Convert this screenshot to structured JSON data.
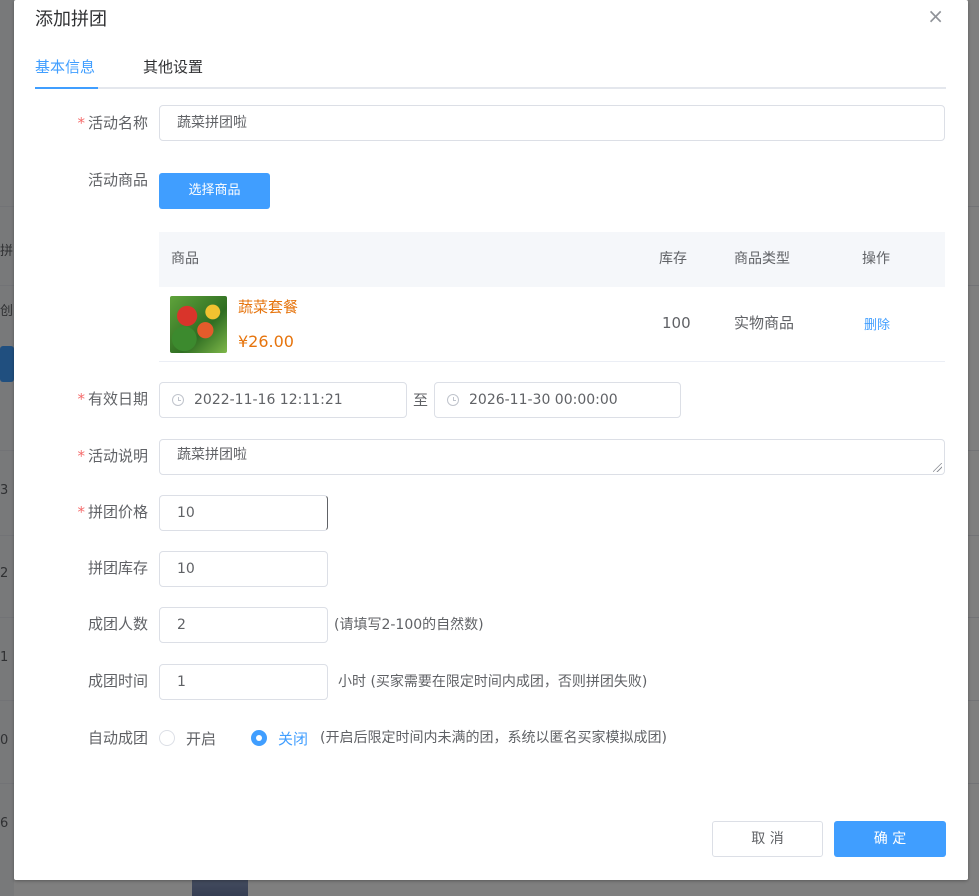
{
  "background": {
    "chars": [
      "拼团",
      "创",
      "3",
      "2",
      "1",
      "0",
      "6"
    ]
  },
  "dialog": {
    "title": "添加拼团",
    "close_glyph": "×"
  },
  "tabs": [
    {
      "label": "基本信息",
      "active": true
    },
    {
      "label": "其他设置",
      "active": false
    }
  ],
  "form": {
    "required_mark": "*",
    "activity_name": {
      "label": "活动名称",
      "value": "蔬菜拼团啦"
    },
    "activity_goods": {
      "label": "活动商品",
      "button": "选择商品"
    },
    "goods_table": {
      "headers": {
        "goods": "商品",
        "stock": "库存",
        "type": "商品类型",
        "action": "操作"
      },
      "rows": [
        {
          "name": "蔬菜套餐",
          "price": "¥26.00",
          "stock": "100",
          "type": "实物商品",
          "action": "删除"
        }
      ]
    },
    "valid_date": {
      "label": "有效日期",
      "start": "2022-11-16 12:11:21",
      "separator": "至",
      "end": "2026-11-30 00:00:00"
    },
    "description": {
      "label": "活动说明",
      "value": "蔬菜拼团啦"
    },
    "group_price": {
      "label": "拼团价格",
      "value": "10"
    },
    "group_stock": {
      "label": "拼团库存",
      "value": "10"
    },
    "group_size": {
      "label": "成团人数",
      "value": "2",
      "hint": "(请填写2-100的自然数)"
    },
    "group_time": {
      "label": "成团时间",
      "value": "1",
      "hint": "小时 (买家需要在限定时间内成团，否则拼团失败)"
    },
    "auto_group": {
      "label": "自动成团",
      "options": [
        {
          "label": "开启",
          "checked": false
        },
        {
          "label": "关闭",
          "checked": true
        }
      ],
      "hint": "(开启后限定时间内未满的团，系统以匿名买家模拟成团)"
    }
  },
  "footer": {
    "cancel": "取 消",
    "confirm": "确 定"
  },
  "colors": {
    "primary": "#409eff",
    "price": "#e6740d",
    "required": "#f56c6c"
  }
}
